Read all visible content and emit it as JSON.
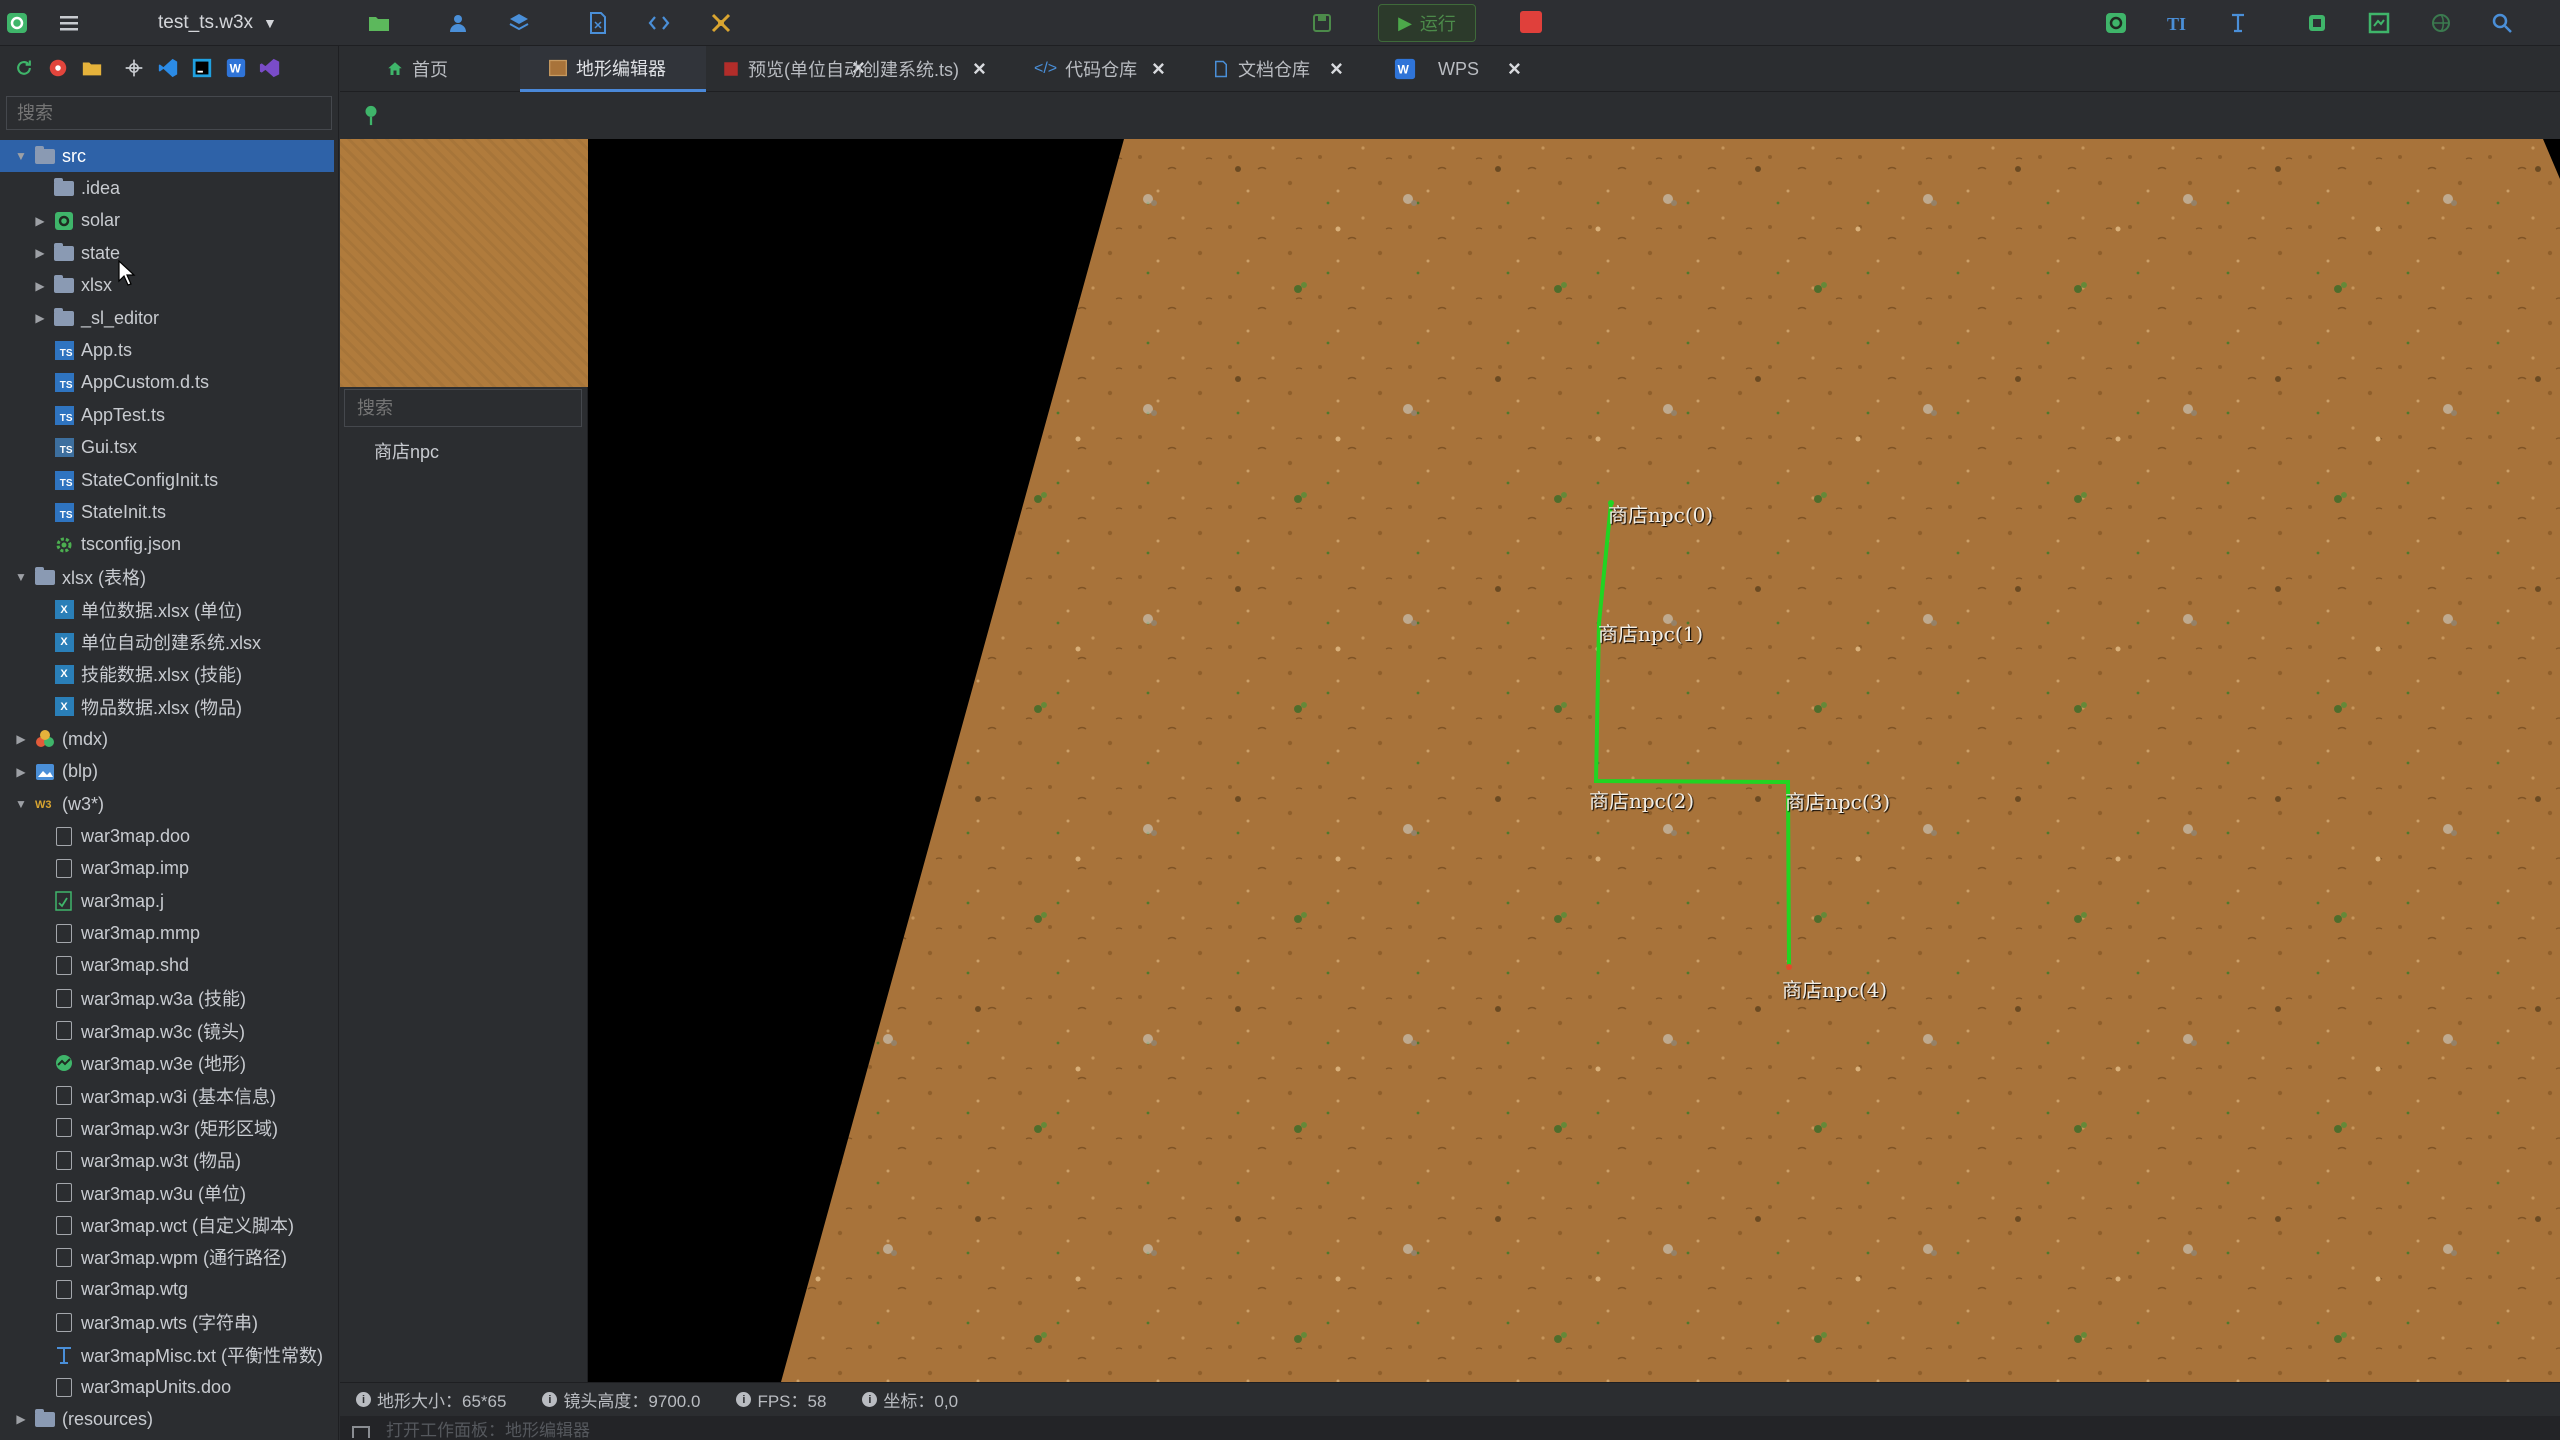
{
  "toolbar": {
    "project_name": "test_ts.w3x",
    "run_label": "运行"
  },
  "sidebar": {
    "search_placeholder": "搜索",
    "tree": [
      {
        "label": "src",
        "depth": 0,
        "expand": "open",
        "icon": "folder-icon",
        "selected": true
      },
      {
        "label": ".idea",
        "depth": 1,
        "expand": "none",
        "icon": "folder-icon"
      },
      {
        "label": "solar",
        "depth": 1,
        "expand": "closed",
        "icon": "solar-icon"
      },
      {
        "label": "state",
        "depth": 1,
        "expand": "closed",
        "icon": "folder-icon"
      },
      {
        "label": "xlsx",
        "depth": 1,
        "expand": "closed",
        "icon": "folder-icon"
      },
      {
        "label": "_sl_editor",
        "depth": 1,
        "expand": "closed",
        "icon": "folder-icon"
      },
      {
        "label": "App.ts",
        "depth": 1,
        "expand": "none",
        "icon": "ts-file-icon"
      },
      {
        "label": "AppCustom.d.ts",
        "depth": 1,
        "expand": "none",
        "icon": "ts-file-icon"
      },
      {
        "label": "AppTest.ts",
        "depth": 1,
        "expand": "none",
        "icon": "ts-file-icon"
      },
      {
        "label": "Gui.tsx",
        "depth": 1,
        "expand": "none",
        "icon": "tsx-file-icon"
      },
      {
        "label": "StateConfigInit.ts",
        "depth": 1,
        "expand": "none",
        "icon": "ts-file-icon"
      },
      {
        "label": "StateInit.ts",
        "depth": 1,
        "expand": "none",
        "icon": "ts-file-icon"
      },
      {
        "label": "tsconfig.json",
        "depth": 1,
        "expand": "none",
        "icon": "json-gear-icon"
      },
      {
        "label": "xlsx (表格)",
        "depth": 0,
        "expand": "open",
        "icon": "folder-icon"
      },
      {
        "label": "单位数据.xlsx (单位)",
        "depth": 1,
        "expand": "none",
        "icon": "excel-file-icon"
      },
      {
        "label": "单位自动创建系统.xlsx",
        "depth": 1,
        "expand": "none",
        "icon": "excel-file-icon"
      },
      {
        "label": "技能数据.xlsx (技能)",
        "depth": 1,
        "expand": "none",
        "icon": "excel-file-icon"
      },
      {
        "label": "物品数据.xlsx (物品)",
        "depth": 1,
        "expand": "none",
        "icon": "excel-file-icon"
      },
      {
        "label": "(mdx)",
        "depth": 0,
        "expand": "closed",
        "icon": "model-icon"
      },
      {
        "label": "(blp)",
        "depth": 0,
        "expand": "closed",
        "icon": "image-icon"
      },
      {
        "label": "(w3*)",
        "depth": 0,
        "expand": "open",
        "icon": "w3-icon"
      },
      {
        "label": "war3map.doo",
        "depth": 1,
        "expand": "none",
        "icon": "file-icon"
      },
      {
        "label": "war3map.imp",
        "depth": 1,
        "expand": "none",
        "icon": "file-icon"
      },
      {
        "label": "war3map.j",
        "depth": 1,
        "expand": "none",
        "icon": "jass-file-icon"
      },
      {
        "label": "war3map.mmp",
        "depth": 1,
        "expand": "none",
        "icon": "file-icon"
      },
      {
        "label": "war3map.shd",
        "depth": 1,
        "expand": "none",
        "icon": "file-icon"
      },
      {
        "label": "war3map.w3a (技能)",
        "depth": 1,
        "expand": "none",
        "icon": "file-icon"
      },
      {
        "label": "war3map.w3c (镜头)",
        "depth": 1,
        "expand": "none",
        "icon": "file-icon"
      },
      {
        "label": "war3map.w3e (地形)",
        "depth": 1,
        "expand": "none",
        "icon": "terrain-file-icon"
      },
      {
        "label": "war3map.w3i (基本信息)",
        "depth": 1,
        "expand": "none",
        "icon": "file-icon"
      },
      {
        "label": "war3map.w3r (矩形区域)",
        "depth": 1,
        "expand": "none",
        "icon": "file-icon"
      },
      {
        "label": "war3map.w3t (物品)",
        "depth": 1,
        "expand": "none",
        "icon": "file-icon"
      },
      {
        "label": "war3map.w3u (单位)",
        "depth": 1,
        "expand": "none",
        "icon": "file-icon"
      },
      {
        "label": "war3map.wct (自定义脚本)",
        "depth": 1,
        "expand": "none",
        "icon": "file-icon"
      },
      {
        "label": "war3map.wpm (通行路径)",
        "depth": 1,
        "expand": "none",
        "icon": "file-icon"
      },
      {
        "label": "war3map.wtg",
        "depth": 1,
        "expand": "none",
        "icon": "file-icon"
      },
      {
        "label": "war3map.wts (字符串)",
        "depth": 1,
        "expand": "none",
        "icon": "file-icon"
      },
      {
        "label": "war3mapMisc.txt (平衡性常数)",
        "depth": 1,
        "expand": "none",
        "icon": "text-file-icon"
      },
      {
        "label": "war3mapUnits.doo",
        "depth": 1,
        "expand": "none",
        "icon": "file-icon"
      },
      {
        "label": "(resources)",
        "depth": 0,
        "expand": "closed",
        "icon": "folder-icon"
      }
    ]
  },
  "tabs": [
    {
      "label": "首页",
      "icon": "home-icon",
      "active": false
    },
    {
      "label": "地形编辑器",
      "icon": "terrain-icon",
      "active": true
    },
    {
      "label": "预览(单位自动创建系统.ts)",
      "icon": "preview-icon",
      "active": false
    },
    {
      "label": "代码仓库",
      "icon": "code-icon",
      "active": false
    },
    {
      "label": "文档仓库",
      "icon": "doc-icon",
      "active": false
    },
    {
      "label": "WPS",
      "icon": "wps-icon",
      "active": false
    }
  ],
  "object_panel": {
    "search_placeholder": "搜索",
    "items": [
      "商店npc"
    ]
  },
  "viewport": {
    "npc_labels": [
      "商店npc(0)",
      "商店npc(1)",
      "商店npc(2)",
      "商店npc(3)",
      "商店npc(4)"
    ],
    "path_color": "#22d422",
    "terrain_color": "#a8733a"
  },
  "status": {
    "terrain_size": "地形大小：65*65",
    "camera_height": "镜头高度：9700.0",
    "fps": "FPS：58",
    "coords": "坐标：0,0"
  },
  "bottom_hint": "打开工作面板：地形编辑器"
}
